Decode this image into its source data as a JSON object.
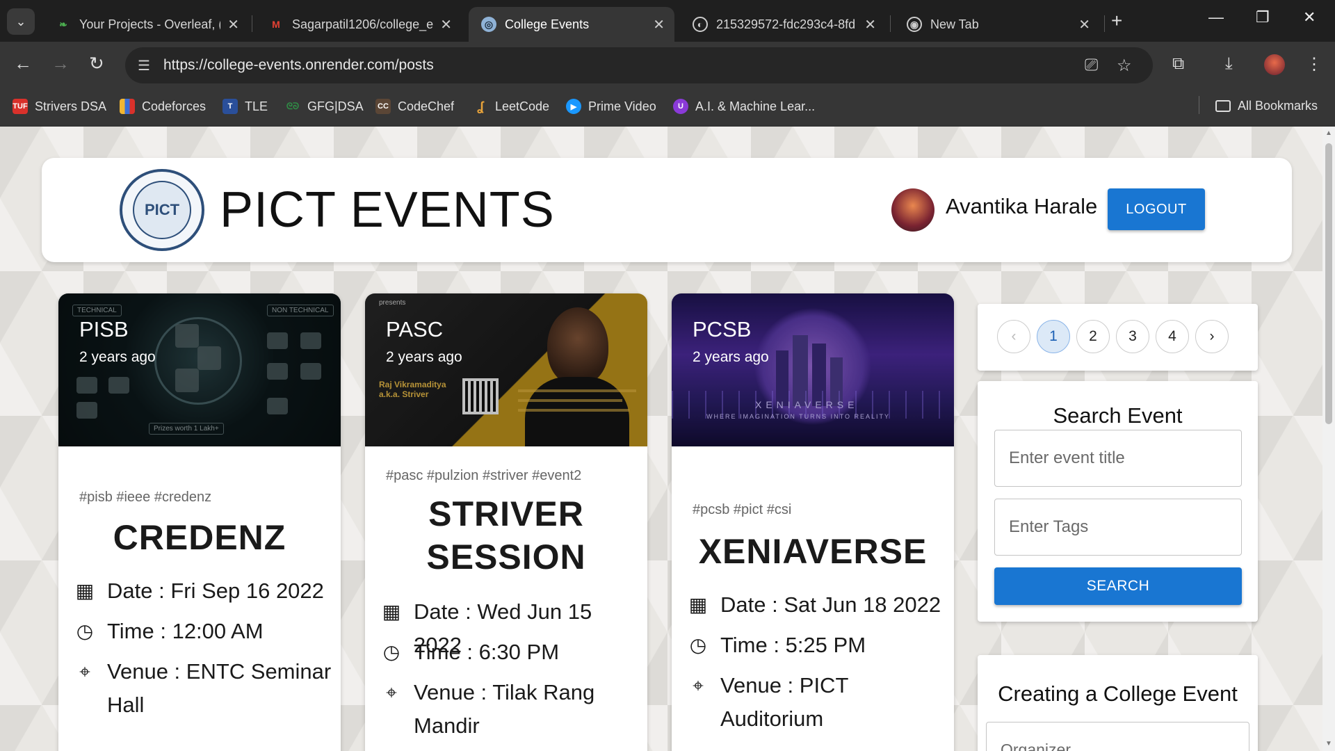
{
  "browser": {
    "tabs": [
      {
        "title": "Your Projects - Overleaf, (",
        "favicon": "overleaf-icon",
        "active": false
      },
      {
        "title": "Sagarpatil1206/college_e",
        "favicon": "gmail-icon",
        "active": false
      },
      {
        "title": "College Events",
        "favicon": "site-icon",
        "active": true
      },
      {
        "title": "215329572-fdc293c4-8fd",
        "favicon": "globe-icon",
        "active": false
      },
      {
        "title": "New Tab",
        "favicon": "chrome-icon",
        "active": false
      }
    ],
    "url": "https://college-events.onrender.com/posts",
    "bookmarks": [
      {
        "label": "Strivers DSA",
        "icon": "TUF",
        "color": "#d9312b"
      },
      {
        "label": "Codeforces",
        "icon": "bars",
        "color": "#3b6fd8"
      },
      {
        "label": "TLE",
        "icon": "T",
        "color": "#2a4f9a"
      },
      {
        "label": "GFG|DSA",
        "icon": "GG",
        "color": "#2f8d46"
      },
      {
        "label": "CodeChef",
        "icon": "CC",
        "color": "#5b4636"
      },
      {
        "label": "LeetCode",
        "icon": "L",
        "color": "#e8a33a"
      },
      {
        "label": "Prime Video",
        "icon": "▶",
        "color": "#1a98ff"
      },
      {
        "label": "A.I. & Machine Lear...",
        "icon": "U",
        "color": "#8a3ad8"
      }
    ],
    "all_bookmarks": "All Bookmarks"
  },
  "header": {
    "logo_text": "PICT",
    "brand": "PICT EVENTS",
    "user_name": "Avantika Harale",
    "logout_label": "LOGOUT"
  },
  "events": [
    {
      "creator": "PISB",
      "ago": "2 years ago",
      "tags": "#pisb #ieee #credenz",
      "title": "CREDENZ",
      "date": "Date : Fri Sep 16 2022",
      "time": "Time : 12:00 AM",
      "venue": "Venue : ENTC Seminar Hall",
      "art": {
        "left": "TECHNICAL",
        "right": "NON TECHNICAL",
        "bottom": "Prizes worth 1 Lakh+"
      }
    },
    {
      "creator": "PASC",
      "ago": "2 years ago",
      "tags": "#pasc #pulzion #striver #event2",
      "title": "STRIVER SESSION",
      "date": "Date : Wed Jun 15 2022",
      "time": "Time : 6:30 PM",
      "venue": "Venue : Tilak Rang Mandir",
      "art": {
        "top": "presents",
        "speaker": "Raj Vikramaditya a.k.a. Striver"
      }
    },
    {
      "creator": "PCSB",
      "ago": "2 years ago",
      "tags": "#pcsb #pict #csi",
      "title": "XENIAVERSE",
      "date": "Date : Sat Jun 18 2022",
      "time": "Time : 5:25 PM",
      "venue": "Venue : PICT Auditorium",
      "art": {
        "name": "XENIAVERSE",
        "tagline": "WHERE IMAGINATION TURNS INTO REALITY"
      }
    }
  ],
  "pagination": {
    "pages": [
      "1",
      "2",
      "3",
      "4"
    ],
    "current": "1",
    "prev": "‹",
    "next": "›"
  },
  "search": {
    "title": "Search Event",
    "title_placeholder": "Enter event title",
    "tags_placeholder": "Enter Tags",
    "button": "SEARCH"
  },
  "create": {
    "title": "Creating a College Event",
    "organizer_placeholder": "Organizer"
  }
}
